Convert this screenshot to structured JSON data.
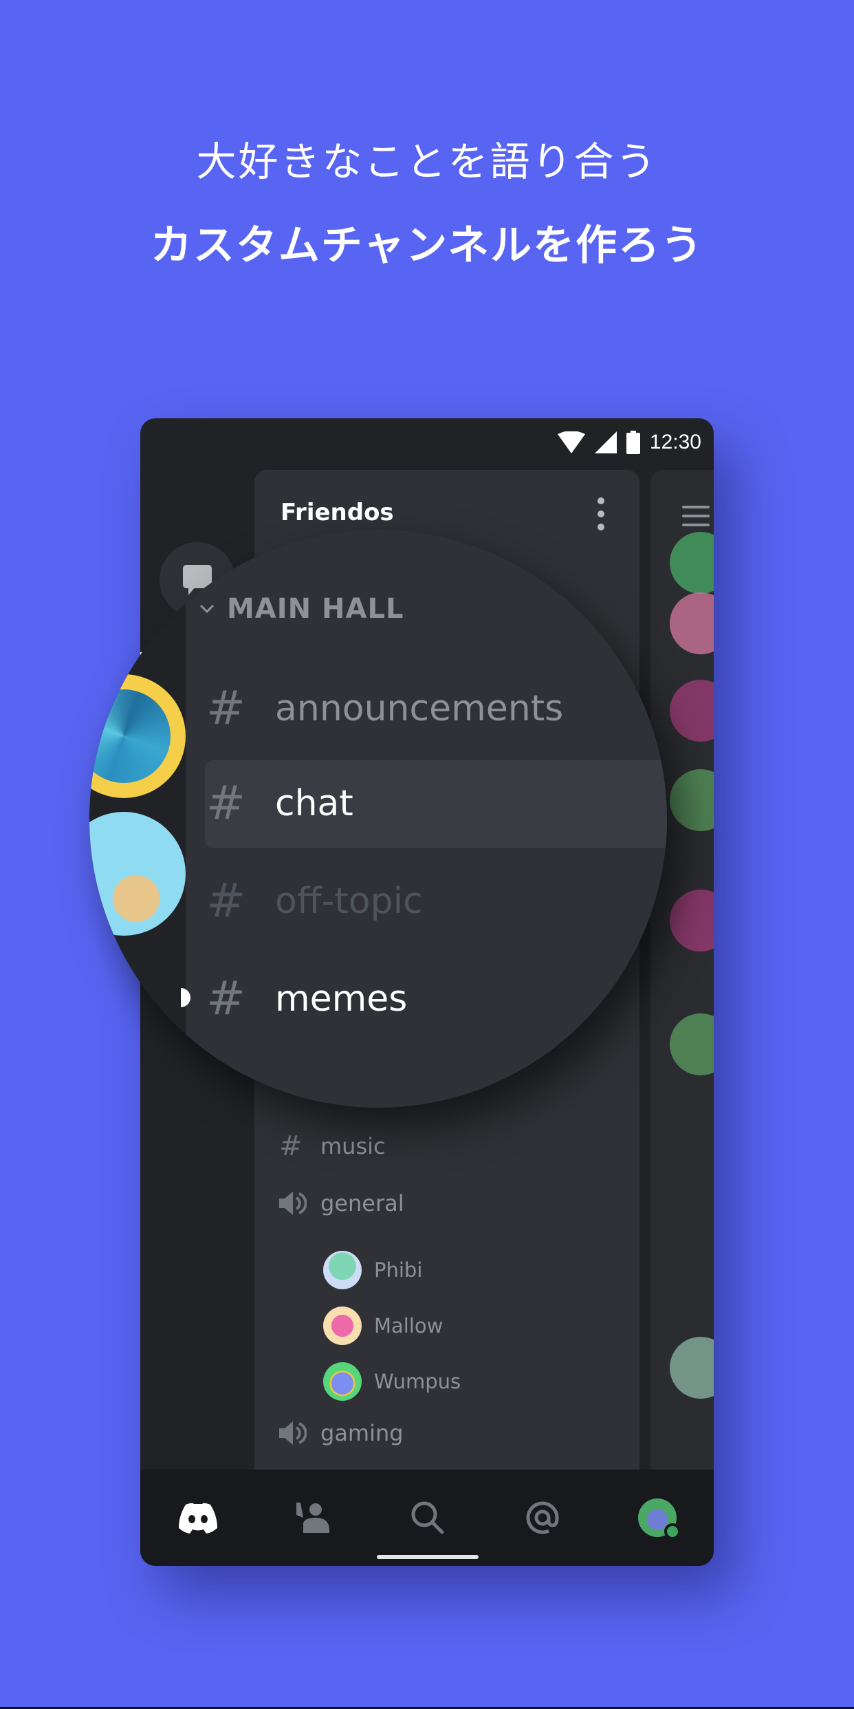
{
  "promo": {
    "line1": "大好きなことを語り合う",
    "line2": "カスタムチャンネルを作ろう"
  },
  "status_bar": {
    "time": "12:30",
    "icons": [
      "wifi-icon",
      "signal-icon",
      "battery-icon"
    ]
  },
  "server": {
    "name": "Friendos",
    "menu_icon": "kebab-menu-icon"
  },
  "category": {
    "name": "MAIN HALL",
    "collapsed": false
  },
  "text_channels": [
    {
      "name": "announcements",
      "state": "normal"
    },
    {
      "name": "chat",
      "state": "selected"
    },
    {
      "name": "off-topic",
      "state": "muted"
    },
    {
      "name": "memes",
      "state": "unread"
    },
    {
      "name": "music",
      "state": "normal"
    }
  ],
  "voice_channels": [
    {
      "name": "general",
      "members": [
        "Phibi",
        "Mallow",
        "Wumpus"
      ]
    },
    {
      "name": "gaming",
      "members": []
    }
  ],
  "bottom_nav": [
    {
      "icon": "discord-home-icon",
      "active": true
    },
    {
      "icon": "friends-icon",
      "active": false
    },
    {
      "icon": "search-icon",
      "active": false
    },
    {
      "icon": "mentions-icon",
      "active": false
    },
    {
      "icon": "profile-avatar",
      "active": false,
      "status": "online"
    }
  ],
  "colors": {
    "background": "#5865F2",
    "accent_online": "#3BA55D",
    "panel": "#2F3136",
    "rail": "#202225"
  }
}
